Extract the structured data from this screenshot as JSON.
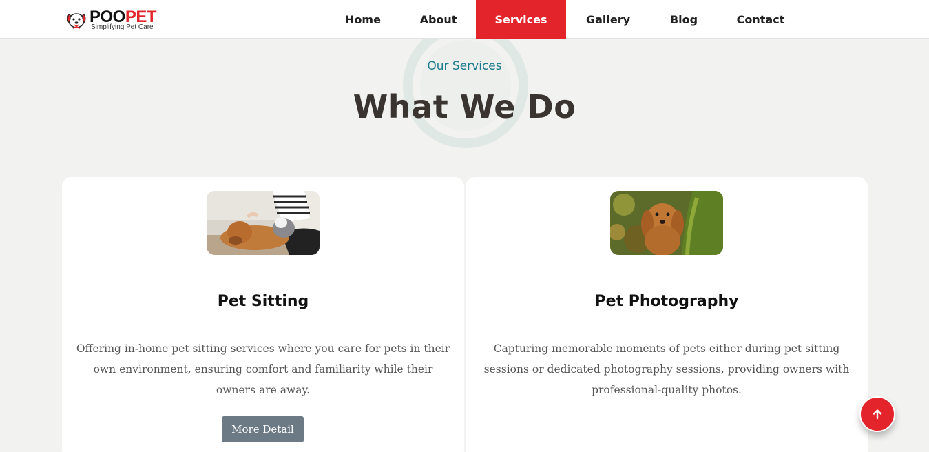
{
  "brand": {
    "name_part1": "POO",
    "name_part2": "PET",
    "tagline": "Simplifying Pet Care",
    "primary_color": "#e3242b"
  },
  "nav": {
    "items": [
      {
        "label": "Home",
        "active": false
      },
      {
        "label": "About",
        "active": false
      },
      {
        "label": "Services",
        "active": true
      },
      {
        "label": "Gallery",
        "active": false
      },
      {
        "label": "Blog",
        "active": false
      },
      {
        "label": "Contact",
        "active": false
      }
    ]
  },
  "section": {
    "eyebrow": "Our Services",
    "title": "What We Do"
  },
  "services": [
    {
      "title": "Pet Sitting",
      "description": "Offering in-home pet sitting services where you care for pets in their own environment, ensuring comfort and familiarity while their owners are away.",
      "button_label": "More Detail",
      "image": "dog-and-cat-with-owner-photo"
    },
    {
      "title": "Pet Photography",
      "description": "Capturing memorable moments of pets either during pet sitting sessions or dedicated photography sessions, providing owners with professional-quality photos.",
      "image": "spaniel-puppy-behind-tree-photo"
    }
  ],
  "back_to_top": {
    "icon": "arrow-up-icon"
  }
}
